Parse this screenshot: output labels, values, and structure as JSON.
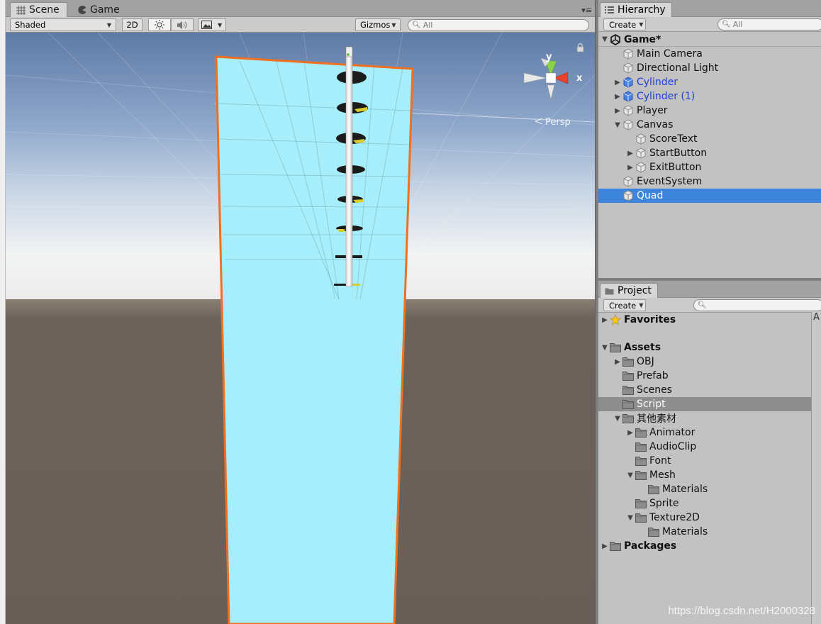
{
  "scene_tabs": [
    {
      "label": "Scene",
      "icon": "grid-icon"
    },
    {
      "label": "Game",
      "icon": "pacman-icon"
    }
  ],
  "scene_toolbar": {
    "shading": "Shaded",
    "mode_2d": "2D",
    "gizmos": "Gizmos",
    "search_placeholder": "All"
  },
  "viewport": {
    "gizmo_axis_y": "y",
    "gizmo_axis_x": "x",
    "projection": "Persp"
  },
  "hierarchy": {
    "tab_label": "Hierarchy",
    "create_label": "Create",
    "search_placeholder": "All",
    "scene_name": "Game*",
    "items": [
      {
        "label": "Main Camera"
      },
      {
        "label": "Directional Light"
      },
      {
        "label": "Cylinder"
      },
      {
        "label": "Cylinder (1)"
      },
      {
        "label": "Player"
      },
      {
        "label": "Canvas"
      },
      {
        "label": "ScoreText"
      },
      {
        "label": "StartButton"
      },
      {
        "label": "ExitButton"
      },
      {
        "label": "EventSystem"
      },
      {
        "label": "Quad"
      }
    ]
  },
  "project": {
    "tab_label": "Project",
    "create_label": "Create",
    "favorites_label": "Favorites",
    "assets_label": "Assets",
    "items": [
      {
        "label": "OBJ"
      },
      {
        "label": "Prefab"
      },
      {
        "label": "Scenes"
      },
      {
        "label": "Script"
      },
      {
        "label": "其他素材"
      },
      {
        "label": "Animator"
      },
      {
        "label": "AudioClip"
      },
      {
        "label": "Font"
      },
      {
        "label": "Mesh"
      },
      {
        "label": "Materials"
      },
      {
        "label": "Sprite"
      },
      {
        "label": "Texture2D"
      },
      {
        "label": "Materials"
      }
    ],
    "packages_label": "Packages",
    "side_letter": "A"
  },
  "colors": {
    "selection_blue": "#3d84dd",
    "selection_outline": "#f07020",
    "quad_fill": "#a6eefb",
    "prefab_blue": "#1e3fd4"
  },
  "watermark": "https://blog.csdn.net/H2000328"
}
